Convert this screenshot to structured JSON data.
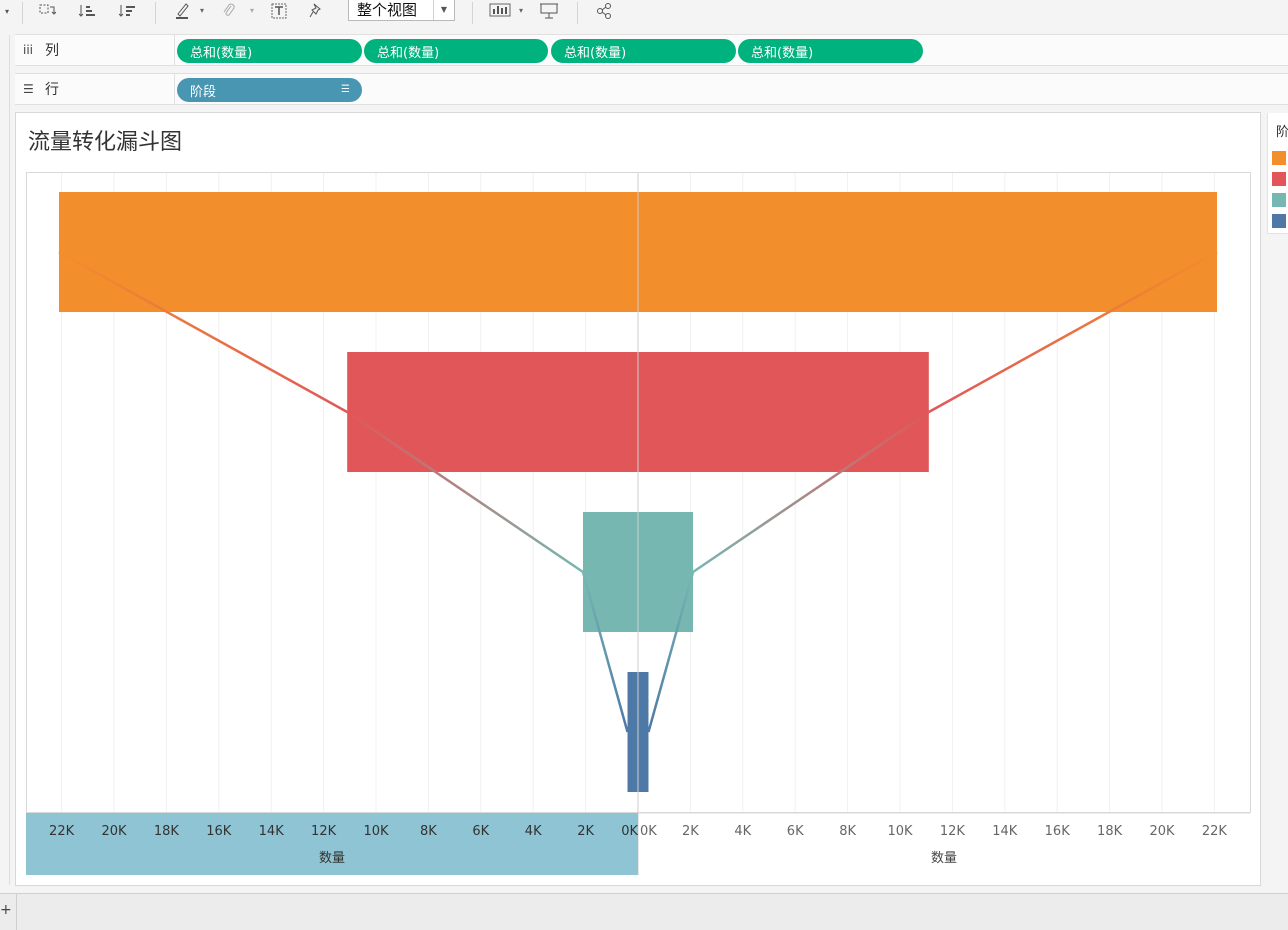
{
  "toolbar": {
    "icons": [
      "swap-icon",
      "sort-ascending-icon",
      "sort-descending-icon",
      "highlight-icon",
      "paperclip-icon",
      "text-label-icon",
      "pin-icon",
      "show-me-icon",
      "presentation-icon",
      "share-icon"
    ],
    "view_mode": "整个视图"
  },
  "shelves": {
    "columns_label": "列",
    "rows_label": "行",
    "column_pills": [
      "总和(数量)",
      "总和(数量)",
      "总和(数量)",
      "总和(数量)"
    ],
    "row_pill": "阶段"
  },
  "sheet": {
    "title": "流量转化漏斗图"
  },
  "legend": {
    "title": "阶",
    "colors": [
      "#f28e2b",
      "#e15759",
      "#76b7b2",
      "#4e79a7"
    ]
  },
  "chart_data": {
    "type": "bar",
    "title": "流量转化漏斗图",
    "orientation": "horizontal-mirrored",
    "series": [
      {
        "color": "#f28e2b",
        "value": 22100
      },
      {
        "color": "#e15759",
        "value": 11100
      },
      {
        "color": "#76b7b2",
        "value": 2100
      },
      {
        "color": "#4e79a7",
        "value": 400
      }
    ],
    "left_axis": {
      "label": "数量",
      "ticks": [
        "22K",
        "20K",
        "18K",
        "16K",
        "14K",
        "12K",
        "10K",
        "8K",
        "6K",
        "4K",
        "2K",
        "0K"
      ],
      "reversed": true
    },
    "right_axis": {
      "label": "数量",
      "ticks": [
        "0K",
        "2K",
        "4K",
        "6K",
        "8K",
        "10K",
        "12K",
        "14K",
        "16K",
        "18K",
        "20K",
        "22K"
      ]
    },
    "xlim": [
      0,
      23000
    ],
    "grid": "vertical",
    "connector_lines": true
  }
}
